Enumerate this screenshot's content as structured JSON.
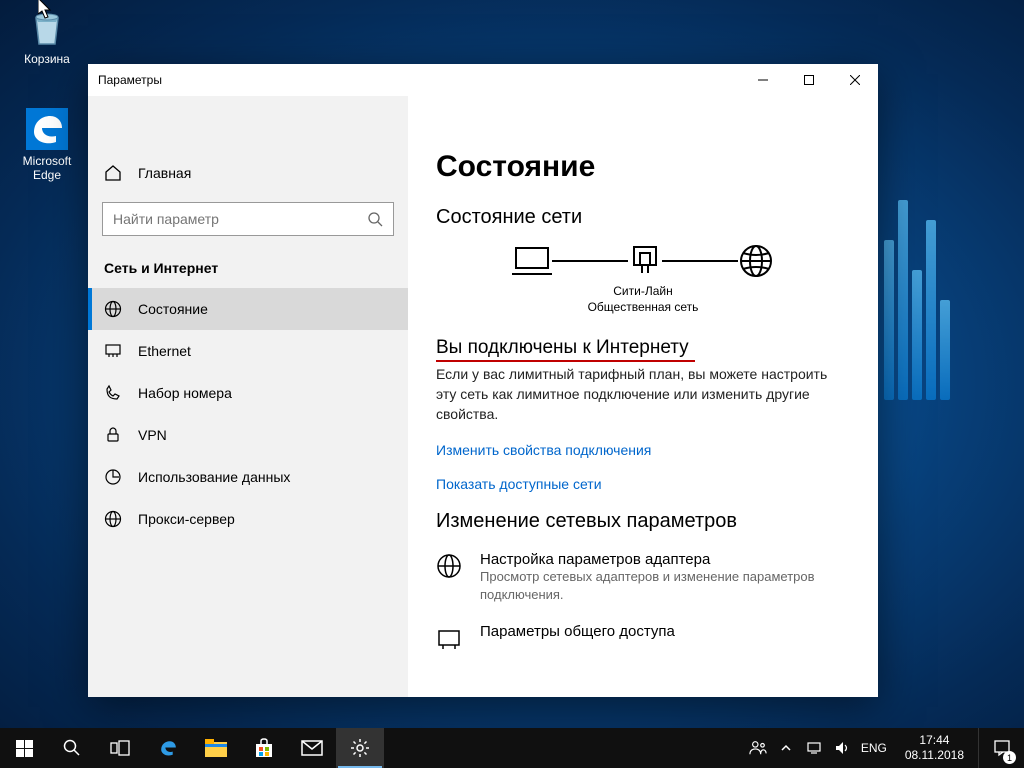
{
  "desktop": {
    "icons": {
      "recycle_bin": "Корзина",
      "edge": "Microsoft Edge"
    }
  },
  "settings": {
    "title": "Параметры",
    "home": "Главная",
    "search_placeholder": "Найти параметр",
    "category": "Сеть и Интернет",
    "nav": [
      {
        "label": "Состояние"
      },
      {
        "label": "Ethernet"
      },
      {
        "label": "Набор номера"
      },
      {
        "label": "VPN"
      },
      {
        "label": "Использование данных"
      },
      {
        "label": "Прокси-сервер"
      }
    ],
    "page": {
      "heading": "Состояние",
      "subheading": "Состояние сети",
      "net_name": "Сити-Лайн",
      "net_type": "Общественная сеть",
      "connected_title": "Вы подключены к Интернету",
      "connected_desc": "Если у вас лимитный тарифный план, вы можете настроить эту сеть как лимитное подключение или изменить другие свойства.",
      "link_change_props": "Изменить свойства подключения",
      "link_show_nets": "Показать доступные сети",
      "change_section": "Изменение сетевых параметров",
      "adapter_title": "Настройка параметров адаптера",
      "adapter_desc": "Просмотр сетевых адаптеров и изменение параметров подключения.",
      "sharing_title": "Параметры общего доступа"
    }
  },
  "taskbar": {
    "lang": "ENG",
    "time": "17:44",
    "date": "08.11.2018",
    "notif_count": "1"
  }
}
